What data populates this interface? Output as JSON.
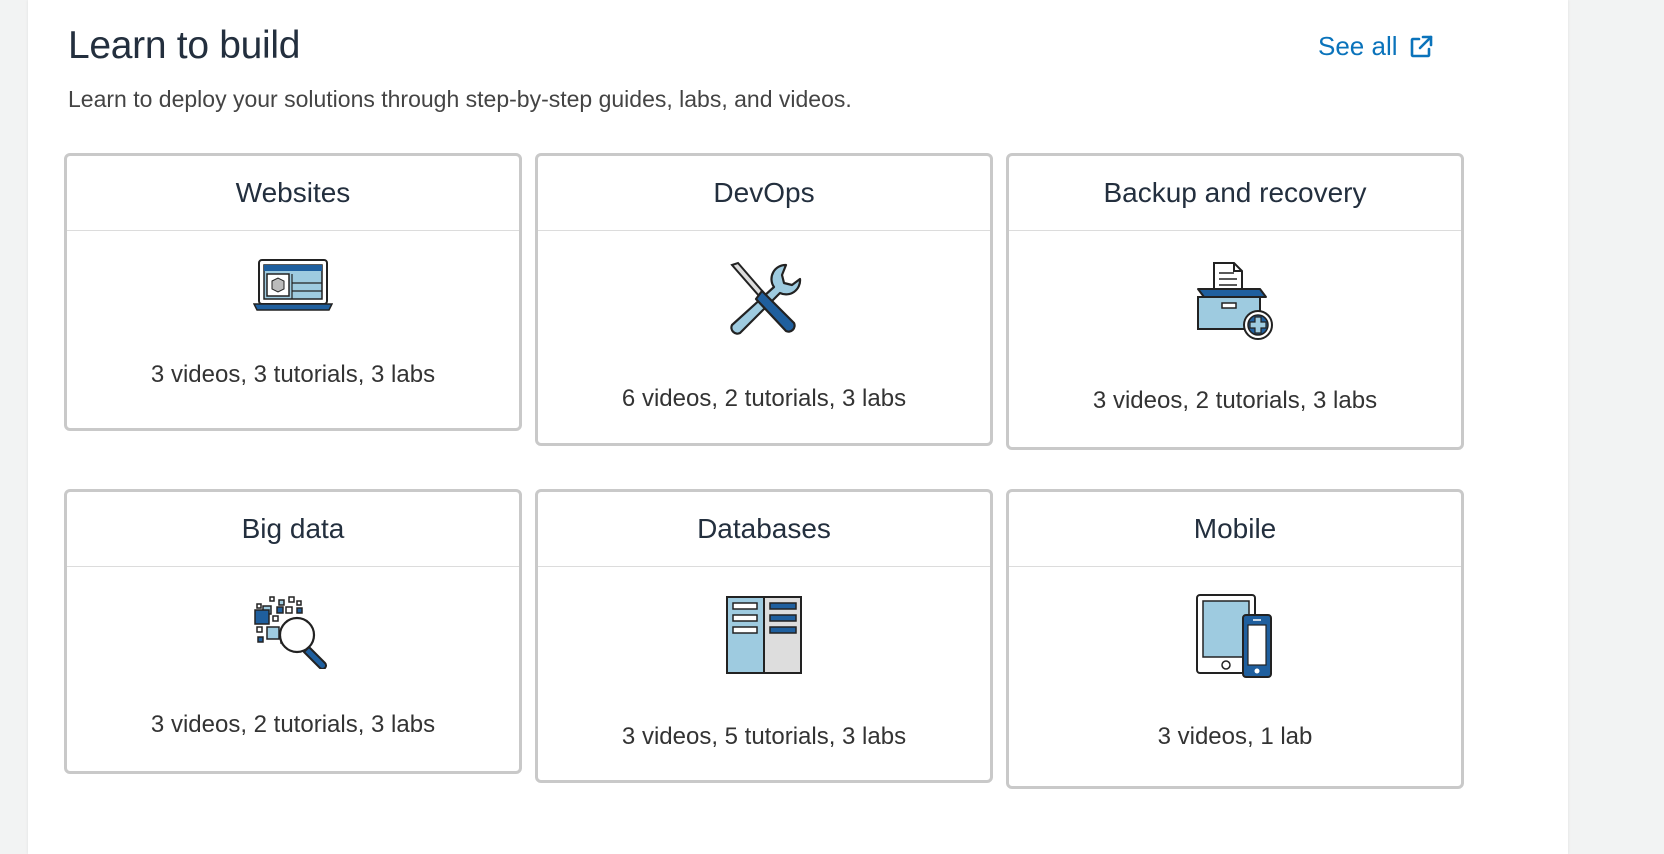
{
  "header": {
    "title": "Learn to build",
    "subtitle": "Learn to deploy your solutions through step-by-step guides, labs, and videos.",
    "see_all": "See all",
    "see_all_icon": "external-link-icon"
  },
  "colors": {
    "accent": "#0a73bb",
    "icon_dark_blue": "#1f5f9e",
    "icon_light_blue": "#9ecbe0",
    "card_border": "#c9c9c9"
  },
  "cards": [
    {
      "title": "Websites",
      "counts": "3 videos, 3 tutorials, 3 labs",
      "icon": "laptop-icon"
    },
    {
      "title": "DevOps",
      "counts": "6 videos, 2 tutorials, 3 labs",
      "icon": "tools-icon"
    },
    {
      "title": "Backup and recovery",
      "counts": "3 videos, 2 tutorials, 3 labs",
      "icon": "archive-box-icon"
    },
    {
      "title": "Big data",
      "counts": "3 videos, 2 tutorials, 3 labs",
      "icon": "data-search-icon"
    },
    {
      "title": "Databases",
      "counts": "3 videos, 5 tutorials, 3 labs",
      "icon": "database-server-icon"
    },
    {
      "title": "Mobile",
      "counts": "3 videos, 1 lab",
      "icon": "mobile-devices-icon"
    }
  ]
}
